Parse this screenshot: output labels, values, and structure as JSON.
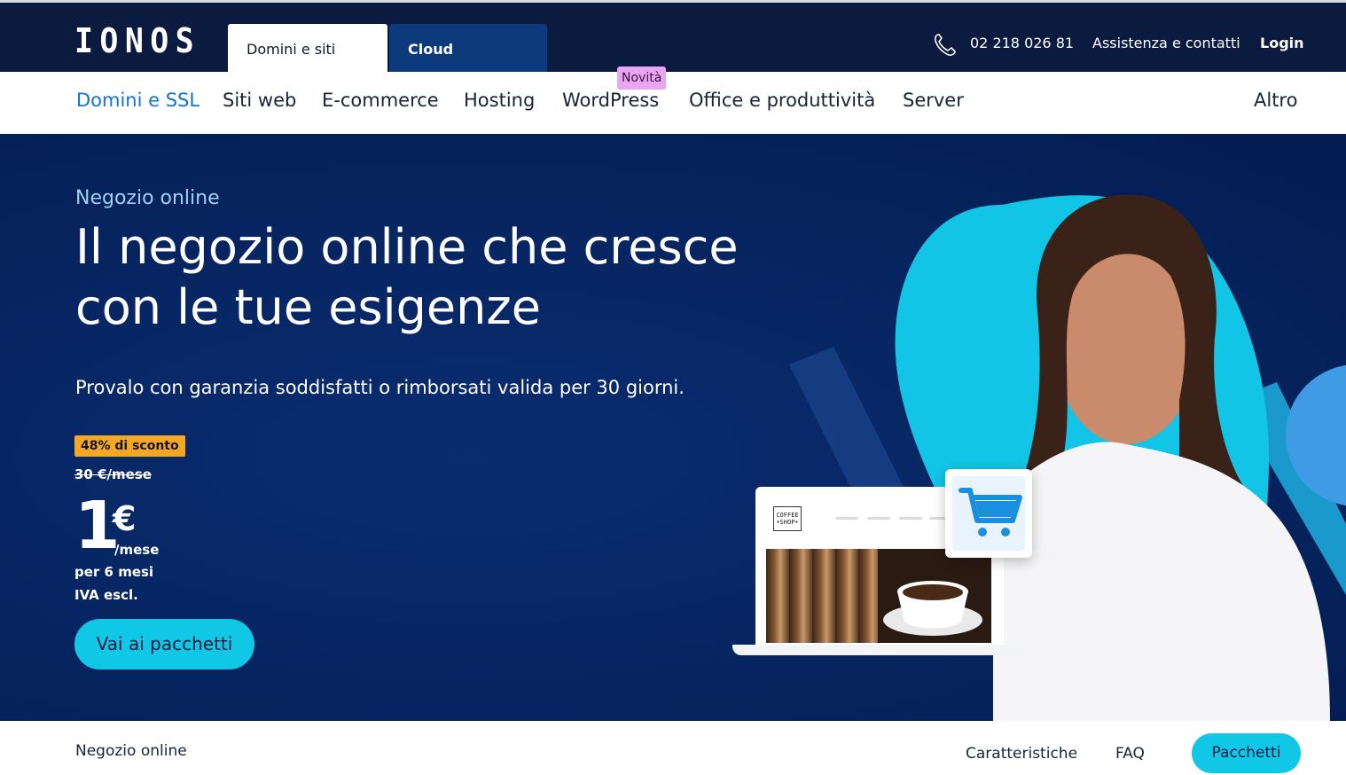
{
  "header": {
    "logo": "IONOS",
    "tabs": [
      {
        "label": "Domini e siti web"
      },
      {
        "label": "Cloud computing"
      }
    ],
    "phone": "02 218 026 81",
    "assistance": "Assistenza e contatti",
    "login": "Login"
  },
  "nav": {
    "items": [
      {
        "label": "Domini e SSL"
      },
      {
        "label": "Siti web"
      },
      {
        "label": "E-commerce"
      },
      {
        "label": "Hosting"
      },
      {
        "label": "WordPress"
      },
      {
        "label": "Office e produttività"
      },
      {
        "label": "Server"
      },
      {
        "label": "Altro"
      }
    ],
    "new_badge": "Novità"
  },
  "hero": {
    "eyebrow": "Negozio online",
    "headline_line1": "Il negozio online che cresce",
    "headline_line2": "con le tue esigenze",
    "subtitle": "Provalo con garanzia soddisfatti o rimborsati valida per 30 giorni.",
    "discount": "48% di sconto",
    "old_price": "30 €/mese",
    "price": "1",
    "currency": "€",
    "price_unit": "/mese",
    "price_period": "per 6 mesi",
    "price_vat": "IVA escl.",
    "cta": "Vai ai pacchetti",
    "laptop_logo_line1": "COFFEE",
    "laptop_logo_line2": "•SHOP•"
  },
  "subnav": {
    "title": "Negozio online",
    "links": [
      {
        "label": "Caratteristiche"
      },
      {
        "label": "FAQ"
      }
    ],
    "button": "Pacchetti"
  },
  "colors": {
    "topbar": "#0b1b3f",
    "cloud_tab": "#0d3a7c",
    "accent_blue": "#1474c9",
    "cta_cyan": "#11c7e6",
    "discount": "#f5a623",
    "badge_new": "#e9a5f0"
  }
}
